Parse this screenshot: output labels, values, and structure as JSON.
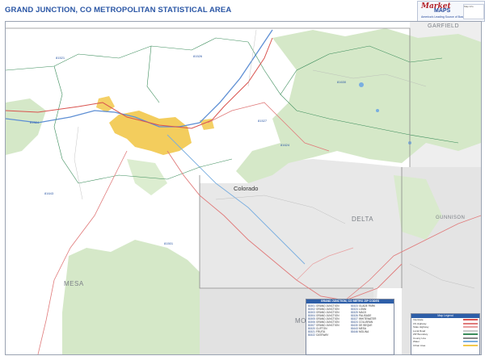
{
  "header": {
    "title": "GRAND JUNCTION, CO METROPOLITAN STATISTICAL AREA"
  },
  "logo": {
    "brand_top": "Market",
    "brand_bottom": "MAPS",
    "tagline": "America's Leading Source of Business Maps",
    "info_text": "Map Info"
  },
  "map": {
    "state_label": "Colorado",
    "counties": {
      "garfield": "GARFIELD",
      "delta": "DELTA",
      "gunnison": "GUNNISON",
      "mesa": "MESA",
      "montrose": "MONTROSE"
    },
    "highway_labels": [
      "81521",
      "81524",
      "81630",
      "81501",
      "81526",
      "81527",
      "81624",
      "81643"
    ]
  },
  "zip_legend": {
    "title": "GRAND JUNCTION, CO METRO ZIP CODES",
    "rows": [
      {
        "zip": "81501",
        "name": "GRAND JUNCTION"
      },
      {
        "zip": "81502",
        "name": "GRAND JUNCTION"
      },
      {
        "zip": "81503",
        "name": "GRAND JUNCTION"
      },
      {
        "zip": "81504",
        "name": "GRAND JUNCTION"
      },
      {
        "zip": "81505",
        "name": "GRAND JUNCTION"
      },
      {
        "zip": "81506",
        "name": "GRAND JUNCTION"
      },
      {
        "zip": "81507",
        "name": "GRAND JUNCTION"
      },
      {
        "zip": "81520",
        "name": "CLIFTON"
      },
      {
        "zip": "81521",
        "name": "FRUITA"
      },
      {
        "zip": "81522",
        "name": "GATEWAY"
      },
      {
        "zip": "81523",
        "name": "GLADE PARK"
      },
      {
        "zip": "81524",
        "name": "LOMA"
      },
      {
        "zip": "81525",
        "name": "MACK"
      },
      {
        "zip": "81526",
        "name": "PALISADE"
      },
      {
        "zip": "81527",
        "name": "WHITEWATER"
      },
      {
        "zip": "81624",
        "name": "COLLBRAN"
      },
      {
        "zip": "81630",
        "name": "DE BEQUE"
      },
      {
        "zip": "81643",
        "name": "MESA"
      },
      {
        "zip": "81646",
        "name": "MOLINA"
      }
    ]
  },
  "map_key": {
    "title": "Map Legend",
    "rows": [
      {
        "label": "Interstate",
        "color": "#d9534f"
      },
      {
        "label": "US Highway",
        "color": "#e07a7a"
      },
      {
        "label": "State Highway",
        "color": "#e8a0a0"
      },
      {
        "label": "Local Road",
        "color": "#c9c9c9"
      },
      {
        "label": "ZIP Boundary",
        "color": "#3a8c5a"
      },
      {
        "label": "County Line",
        "color": "#8a8a8a"
      },
      {
        "label": "Water",
        "color": "#7aaee0"
      },
      {
        "label": "Urban Area",
        "color": "#f2c84b"
      }
    ]
  },
  "colors": {
    "title_blue": "#2a56a5",
    "forest_green": "#d5e8c8",
    "urban_yellow": "#f2c84b",
    "water_blue": "#5e8fd4",
    "interstate_red": "#d9534f",
    "zip_line_green": "#3a8c5a",
    "county_gray": "#e6e6e6"
  }
}
